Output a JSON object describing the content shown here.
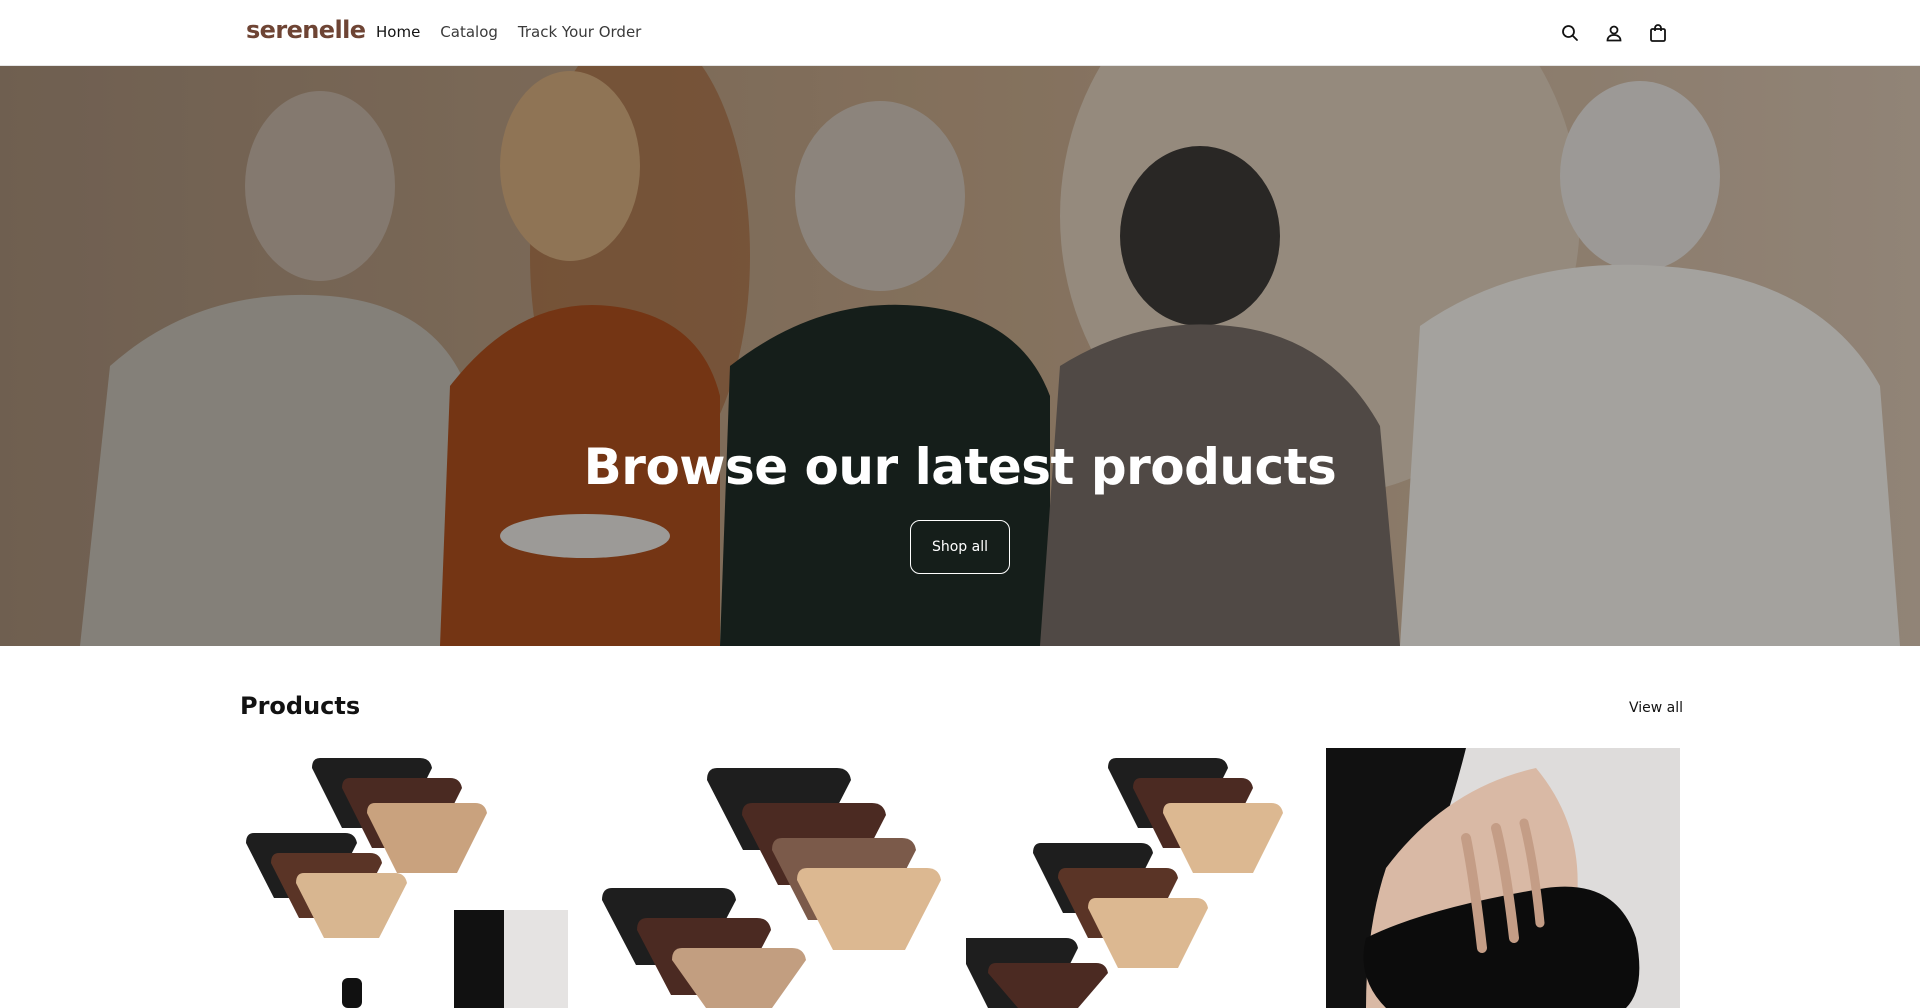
{
  "header": {
    "logo": "serenelle",
    "nav": [
      {
        "label": "Home"
      },
      {
        "label": "Catalog"
      },
      {
        "label": "Track Your Order"
      }
    ],
    "icons": [
      "search-icon",
      "account-icon",
      "cart-icon"
    ]
  },
  "hero": {
    "title": "Browse our latest products",
    "button_label": "Shop all"
  },
  "products": {
    "heading": "Products",
    "view_all_label": "View all",
    "items": [
      {
        "image": "underwear-bundle-with-pouch"
      },
      {
        "image": "underwear-bundle-large"
      },
      {
        "image": "underwear-bundle-multi"
      },
      {
        "image": "model-holding-black-pouch"
      }
    ]
  },
  "colors": {
    "logo": "#6e4434",
    "text": "#121212",
    "hero_text": "#ffffff"
  }
}
